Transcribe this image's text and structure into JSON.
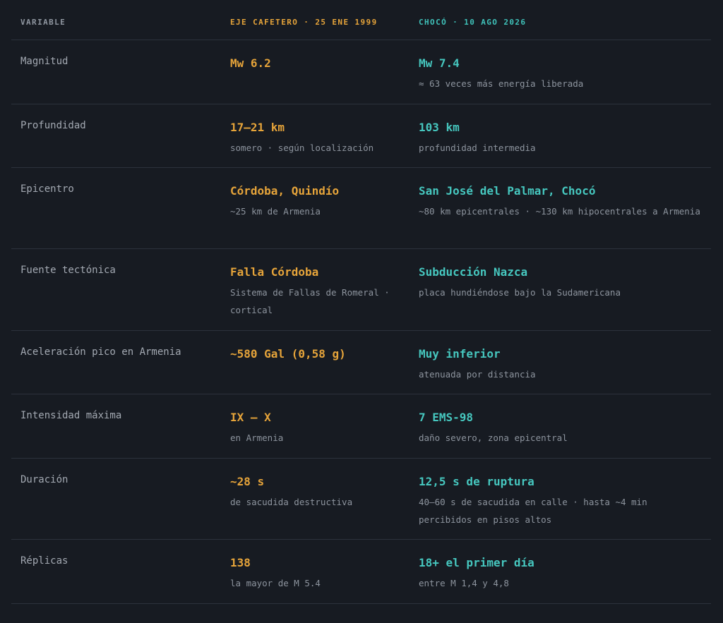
{
  "header": {
    "variable": "VARIABLE",
    "event_a": "EJE CAFETERO · 25 ENE 1999",
    "event_b": "CHOCÓ · 10 AGO 2026"
  },
  "rows": [
    {
      "label": "Magnitud",
      "a_main": "Mw 6.2",
      "a_sub": "",
      "b_main": "Mw 7.4",
      "b_sub": "≈ 63 veces más energía liberada"
    },
    {
      "label": "Profundidad",
      "a_main": "17–21 km",
      "a_sub": "somero · según localización",
      "b_main": "103 km",
      "b_sub": "profundidad intermedia"
    },
    {
      "label": "Epicentro",
      "a_main": "Córdoba, Quindío",
      "a_sub": "~25 km de Armenia",
      "b_main": "San José del Palmar, Chocó",
      "b_sub": "~80 km epicentrales · ~130 km hipocentrales a Armenia"
    },
    {
      "label": "Fuente tectónica",
      "a_main": "Falla Córdoba",
      "a_sub": "Sistema de Fallas de Romeral · cortical",
      "b_main": "Subducción Nazca",
      "b_sub": "placa hundiéndose bajo la Sudamericana"
    },
    {
      "label": "Aceleración pico en Armenia",
      "a_main": "~580 Gal (0,58 g)",
      "a_sub": "",
      "b_main": "Muy inferior",
      "b_sub": "atenuada por distancia"
    },
    {
      "label": "Intensidad máxima",
      "a_main": "IX – X",
      "a_sub": "en Armenia",
      "b_main": "7 EMS-98",
      "b_sub": "daño severo, zona epicentral"
    },
    {
      "label": "Duración",
      "a_main": "~28 s",
      "a_sub": "de sacudida destructiva",
      "b_main": "12,5 s de ruptura",
      "b_sub": "40–60 s de sacudida en calle · hasta ~4 min percibidos en pisos altos"
    },
    {
      "label": "Réplicas",
      "a_main": "138",
      "a_sub": "la mayor de M 5.4",
      "b_main": "18+ el primer día",
      "b_sub": "entre M 1,4 y 4,8"
    }
  ],
  "colors": {
    "background": "#171b22",
    "event_a_accent": "#e6a43a",
    "event_b_accent": "#46c7bf",
    "divider": "#2c323c"
  }
}
